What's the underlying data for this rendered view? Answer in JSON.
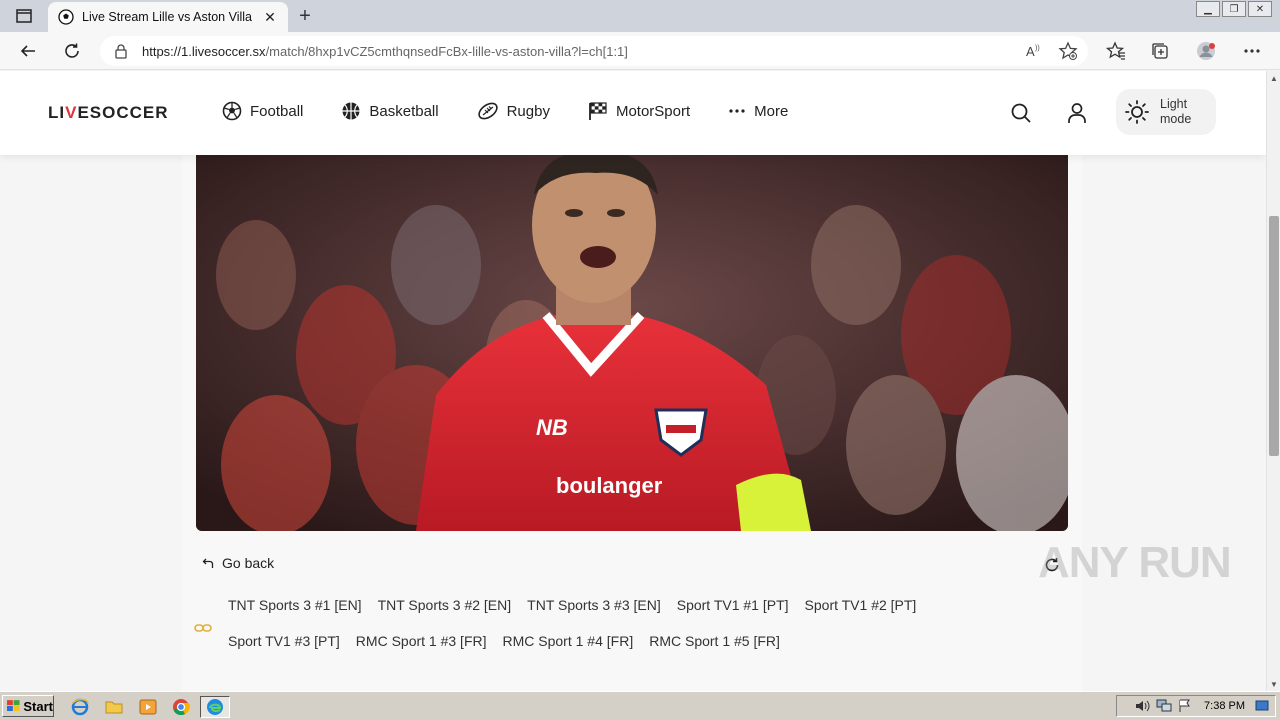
{
  "browser": {
    "tab_title": "Live Stream Lille vs Aston Villa - L",
    "new_tab_label": "+",
    "url_host": "https://1.livesoccer.sx",
    "url_path": "/match/8hxp1vCZ5cmthqnsedFcBx-lille-vs-aston-villa?l=ch[1:1]"
  },
  "site": {
    "logo_part1": "LI",
    "logo_accent": "V",
    "logo_part2": "ESOCCER",
    "nav": [
      {
        "label": "Football",
        "icon": "football-icon"
      },
      {
        "label": "Basketball",
        "icon": "basketball-icon"
      },
      {
        "label": "Rugby",
        "icon": "rugby-icon"
      },
      {
        "label": "MotorSport",
        "icon": "checkered-flag-icon"
      },
      {
        "label": "More",
        "icon": "more-dots-icon"
      }
    ],
    "light_mode_label": "Light mode"
  },
  "player": {
    "sponsor_text": "boulanger",
    "go_back_label": "Go back"
  },
  "channels": [
    "TNT Sports 3 #1 [EN]",
    "TNT Sports 3 #2 [EN]",
    "TNT Sports 3 #3 [EN]",
    "Sport TV1 #1 [PT]",
    "Sport TV1 #2 [PT]",
    "Sport TV1 #3 [PT]",
    "RMC Sport 1 #3 [FR]",
    "RMC Sport 1 #4 [FR]",
    "RMC Sport 1 #5 [FR]"
  ],
  "watermark": "ANY RUN",
  "taskbar": {
    "start_label": "Start",
    "clock": "7:38 PM"
  },
  "colors": {
    "brand_red": "#e0343a",
    "link_icon": "#e0b03a"
  }
}
